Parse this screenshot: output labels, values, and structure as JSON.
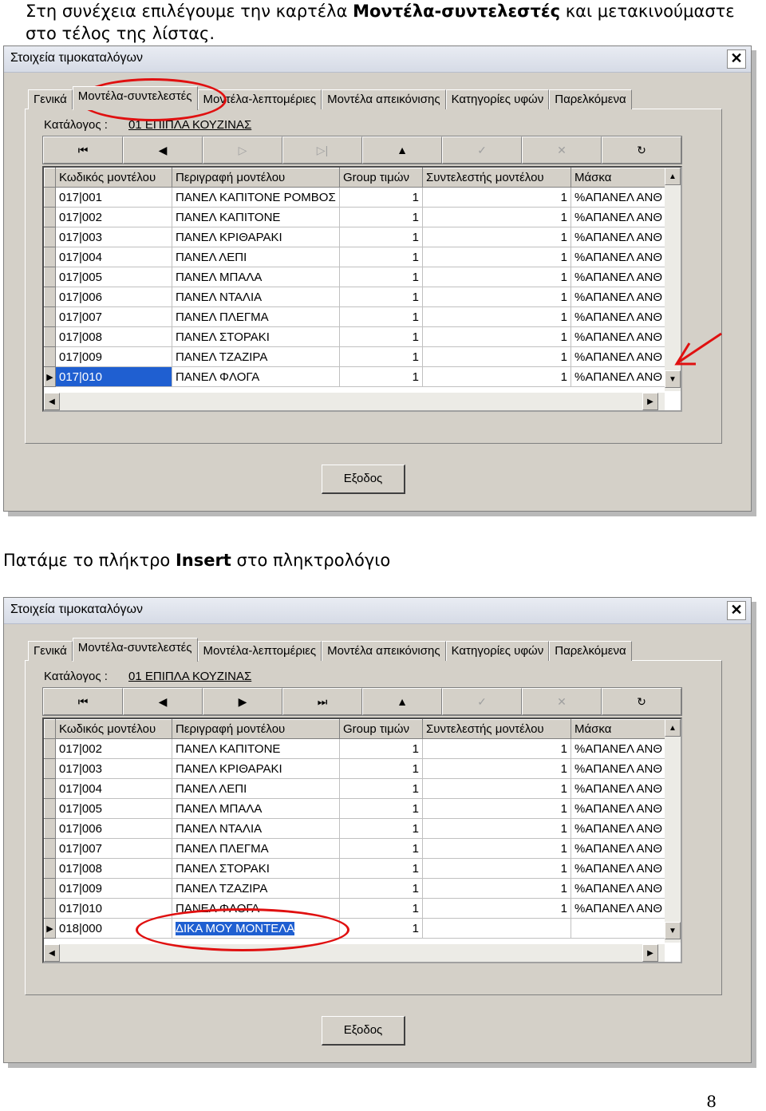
{
  "intro": {
    "pre": "Στη συνέχεια επιλέγουμε την καρτέλα ",
    "bold": "Μοντέλα-συντελεστές",
    "post": " και μετακινούμαστε",
    "line2": "στο τέλος της λίστας."
  },
  "instruction": {
    "pre": "Πατάμε το πλήκτρο ",
    "bold": "Insert",
    "post": " στο πληκτρολόγιο"
  },
  "window": {
    "title": "Στοιχεία τιμοκαταλόγων",
    "close": "✕",
    "tabs": [
      "Γενικά",
      "Μοντέλα-συντελεστές",
      "Μοντέλα-λεπτομέριες",
      "Μοντέλα απεικόνισης",
      "Κατηγορίες υφών",
      "Παρελκόμενα"
    ],
    "catalog_label": "Κατάλογος :",
    "catalog_value": "01 ΕΠΙΠΛΑ ΚΟΥΖΙΝΑΣ",
    "columns": [
      "Κωδικός μοντέλου",
      "Περιγραφή μοντέλου",
      "Group τιμών",
      "Συντελεστής μοντέλου",
      "Μάσκα"
    ],
    "exit_label": "Εξοδος"
  },
  "nav_icons": [
    "first-icon",
    "prev-icon",
    "next-icon",
    "last-icon",
    "insert-icon",
    "post-icon",
    "cancel-icon",
    "refresh-icon"
  ],
  "grid1_rows": [
    [
      "017|001",
      "ΠΑΝΕΛ ΚΑΠΙΤΟΝΕ ΡΟΜΒΟΣ",
      "1",
      "1",
      "%ΑΠΑΝΕΛ ΑΝΘ"
    ],
    [
      "017|002",
      "ΠΑΝΕΛ ΚΑΠΙΤΟΝΕ",
      "1",
      "1",
      "%ΑΠΑΝΕΛ ΑΝΘ"
    ],
    [
      "017|003",
      "ΠΑΝΕΛ ΚΡΙΘΑΡΑΚΙ",
      "1",
      "1",
      "%ΑΠΑΝΕΛ ΑΝΘ"
    ],
    [
      "017|004",
      "ΠΑΝΕΛ ΛΕΠΙ",
      "1",
      "1",
      "%ΑΠΑΝΕΛ ΑΝΘ"
    ],
    [
      "017|005",
      "ΠΑΝΕΛ ΜΠΑΛΑ",
      "1",
      "1",
      "%ΑΠΑΝΕΛ ΑΝΘ"
    ],
    [
      "017|006",
      "ΠΑΝΕΛ ΝΤΑΛΙΑ",
      "1",
      "1",
      "%ΑΠΑΝΕΛ ΑΝΘ"
    ],
    [
      "017|007",
      "ΠΑΝΕΛ ΠΛΕΓΜΑ",
      "1",
      "1",
      "%ΑΠΑΝΕΛ ΑΝΘ"
    ],
    [
      "017|008",
      "ΠΑΝΕΛ ΣΤΟΡΑΚΙ",
      "1",
      "1",
      "%ΑΠΑΝΕΛ ΑΝΘ"
    ],
    [
      "017|009",
      "ΠΑΝΕΛ ΤΖΑΖΙΡΑ",
      "1",
      "1",
      "%ΑΠΑΝΕΛ ΑΝΘ"
    ],
    [
      "017|010",
      "ΠΑΝΕΛ ΦΛΟΓΑ",
      "1",
      "1",
      "%ΑΠΑΝΕΛ ΑΝΘ"
    ]
  ],
  "grid2_rows": [
    [
      "017|002",
      "ΠΑΝΕΛ ΚΑΠΙΤΟΝΕ",
      "1",
      "1",
      "%ΑΠΑΝΕΛ ΑΝΘ"
    ],
    [
      "017|003",
      "ΠΑΝΕΛ ΚΡΙΘΑΡΑΚΙ",
      "1",
      "1",
      "%ΑΠΑΝΕΛ ΑΝΘ"
    ],
    [
      "017|004",
      "ΠΑΝΕΛ ΛΕΠΙ",
      "1",
      "1",
      "%ΑΠΑΝΕΛ ΑΝΘ"
    ],
    [
      "017|005",
      "ΠΑΝΕΛ ΜΠΑΛΑ",
      "1",
      "1",
      "%ΑΠΑΝΕΛ ΑΝΘ"
    ],
    [
      "017|006",
      "ΠΑΝΕΛ ΝΤΑΛΙΑ",
      "1",
      "1",
      "%ΑΠΑΝΕΛ ΑΝΘ"
    ],
    [
      "017|007",
      "ΠΑΝΕΛ ΠΛΕΓΜΑ",
      "1",
      "1",
      "%ΑΠΑΝΕΛ ΑΝΘ"
    ],
    [
      "017|008",
      "ΠΑΝΕΛ ΣΤΟΡΑΚΙ",
      "1",
      "1",
      "%ΑΠΑΝΕΛ ΑΝΘ"
    ],
    [
      "017|009",
      "ΠΑΝΕΛ ΤΖΑΖΙΡΑ",
      "1",
      "1",
      "%ΑΠΑΝΕΛ ΑΝΘ"
    ],
    [
      "017|010",
      "ΠΑΝΕΛ ΦΛΟΓΑ",
      "1",
      "1",
      "%ΑΠΑΝΕΛ ΑΝΘ"
    ],
    [
      "018|000",
      "ΔΙΚΑ ΜΟΥ ΜΟΝΤΕΛΑ",
      "1",
      "",
      ""
    ]
  ],
  "page_number": "8",
  "colors": {
    "selection": "#1f5fd1",
    "highlight_ring": "#e01010",
    "window_face": "#d4d0c8"
  }
}
